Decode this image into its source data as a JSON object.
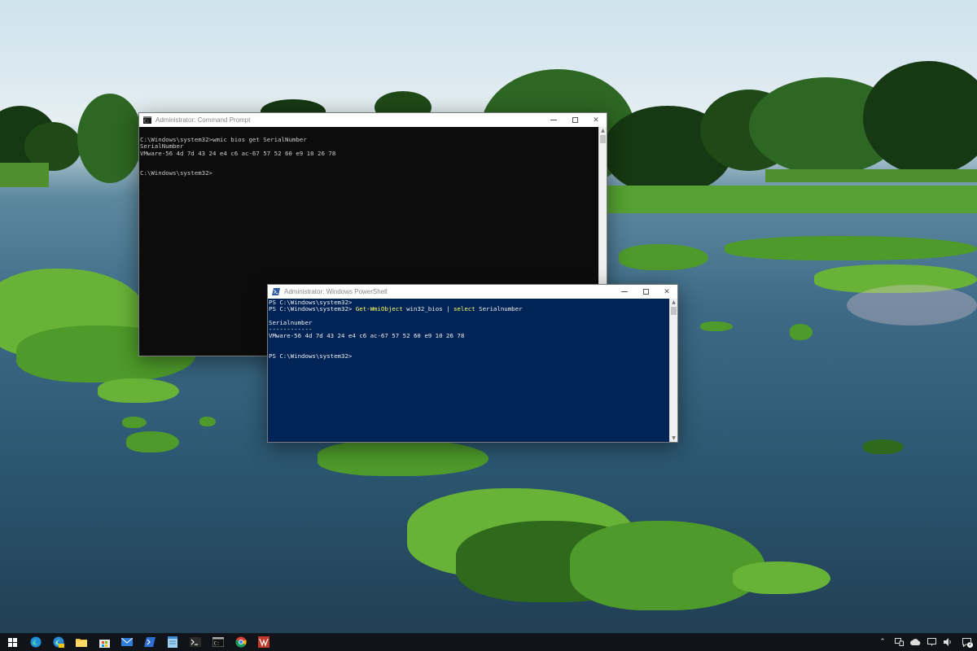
{
  "cmd_window": {
    "title": "Administrator: Command Prompt",
    "lines": [
      "C:\\Windows\\system32>wmic bios get SerialNumber",
      "SerialNumber",
      "VMware-56 4d 7d 43 24 e4 c6 ac-67 57 52 60 e9 10 26 78",
      "",
      "",
      "C:\\Windows\\system32>"
    ]
  },
  "ps_window": {
    "title": "Administrator: Windows PowerShell",
    "line1": "PS C:\\Windows\\system32>",
    "line2_prompt": "PS C:\\Windows\\system32> ",
    "line2_cmdlet": "Get-WmiObject",
    "line2_arg": " win32_bios ",
    "line2_pipe": "| ",
    "line2_select": "select",
    "line2_prop": " Serialnumber",
    "line4": "Serialnumber",
    "line5": "------------",
    "line6": "VMware-56 4d 7d 43 24 e4 c6 ac-67 57 52 60 e9 10 26 78",
    "line9": "PS C:\\Windows\\system32>"
  },
  "taskbar": {
    "items": [
      "start",
      "edge",
      "edge-canary",
      "file-explorer",
      "microsoft-store",
      "mail",
      "powershell",
      "notepad",
      "windows-terminal",
      "command-prompt",
      "chrome",
      "app"
    ],
    "notification_count": "2"
  },
  "colors": {
    "ps_background": "#012456",
    "cmd_background": "#0c0c0c",
    "cmdlet_yellow": "#ffff66"
  }
}
